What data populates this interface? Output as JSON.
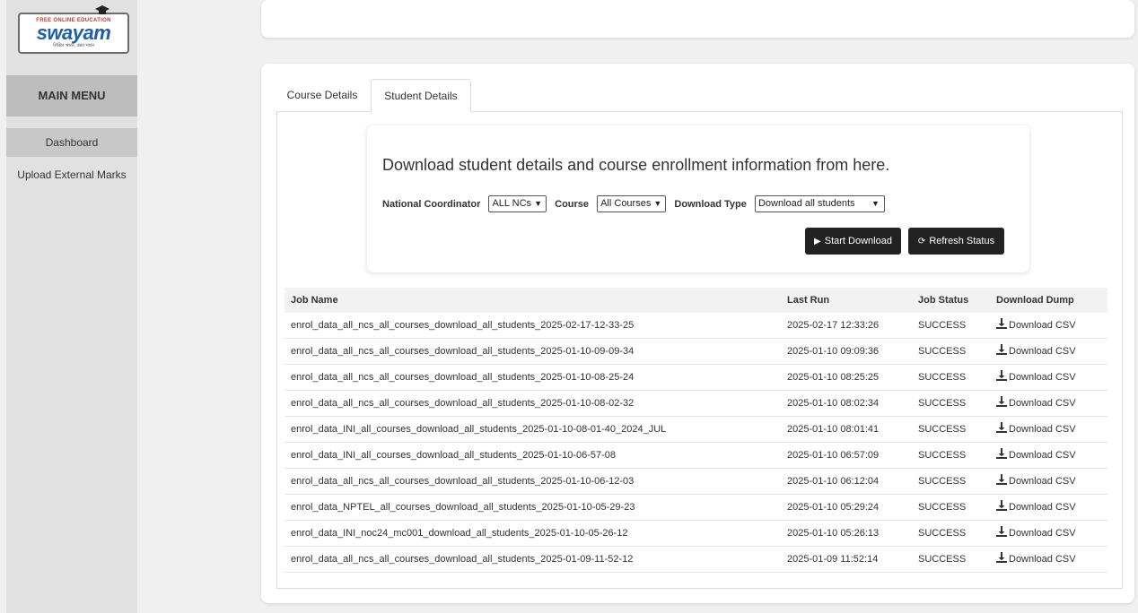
{
  "logo": {
    "top_text": "FREE ONLINE EDUCATION",
    "word": "swayam",
    "sub_text": "शिक्षित भारत, उन्नत भारत"
  },
  "sidebar": {
    "heading": "MAIN MENU",
    "items": [
      {
        "label": "Dashboard",
        "active": true
      },
      {
        "label": "Upload External Marks",
        "active": false
      }
    ]
  },
  "tabs": [
    {
      "label": "Course Details",
      "active": false
    },
    {
      "label": "Student Details",
      "active": true
    }
  ],
  "download": {
    "heading": "Download student details and course enrollment information from here.",
    "filters": {
      "nc_label": "National Coordinator",
      "nc_value": "ALL NCs",
      "course_label": "Course",
      "course_value": "All Courses",
      "type_label": "Download Type",
      "type_value": "Download all students"
    },
    "start_label": "Start Download",
    "refresh_label": "Refresh Status"
  },
  "table": {
    "headers": [
      "Job Name",
      "Last Run",
      "Job Status",
      "Download Dump"
    ],
    "rows": [
      {
        "job": "enrol_data_all_ncs_all_courses_download_all_students_2025-02-17-12-33-25",
        "last_run": "2025-02-17 12:33:26",
        "status": "SUCCESS",
        "action": "Download CSV"
      },
      {
        "job": "enrol_data_all_ncs_all_courses_download_all_students_2025-01-10-09-09-34",
        "last_run": "2025-01-10 09:09:36",
        "status": "SUCCESS",
        "action": "Download CSV"
      },
      {
        "job": "enrol_data_all_ncs_all_courses_download_all_students_2025-01-10-08-25-24",
        "last_run": "2025-01-10 08:25:25",
        "status": "SUCCESS",
        "action": "Download CSV"
      },
      {
        "job": "enrol_data_all_ncs_all_courses_download_all_students_2025-01-10-08-02-32",
        "last_run": "2025-01-10 08:02:34",
        "status": "SUCCESS",
        "action": "Download CSV"
      },
      {
        "job": "enrol_data_INI_all_courses_download_all_students_2025-01-10-08-01-40_2024_JUL",
        "last_run": "2025-01-10 08:01:41",
        "status": "SUCCESS",
        "action": "Download CSV"
      },
      {
        "job": "enrol_data_INI_all_courses_download_all_students_2025-01-10-06-57-08",
        "last_run": "2025-01-10 06:57:09",
        "status": "SUCCESS",
        "action": "Download CSV"
      },
      {
        "job": "enrol_data_all_ncs_all_courses_download_all_students_2025-01-10-06-12-03",
        "last_run": "2025-01-10 06:12:04",
        "status": "SUCCESS",
        "action": "Download CSV"
      },
      {
        "job": "enrol_data_NPTEL_all_courses_download_all_students_2025-01-10-05-29-23",
        "last_run": "2025-01-10 05:29:24",
        "status": "SUCCESS",
        "action": "Download CSV"
      },
      {
        "job": "enrol_data_INI_noc24_mc001_download_all_students_2025-01-10-05-26-12",
        "last_run": "2025-01-10 05:26:13",
        "status": "SUCCESS",
        "action": "Download CSV"
      },
      {
        "job": "enrol_data_all_ncs_all_courses_download_all_students_2025-01-09-11-52-12",
        "last_run": "2025-01-09 11:52:14",
        "status": "SUCCESS",
        "action": "Download CSV"
      }
    ]
  }
}
